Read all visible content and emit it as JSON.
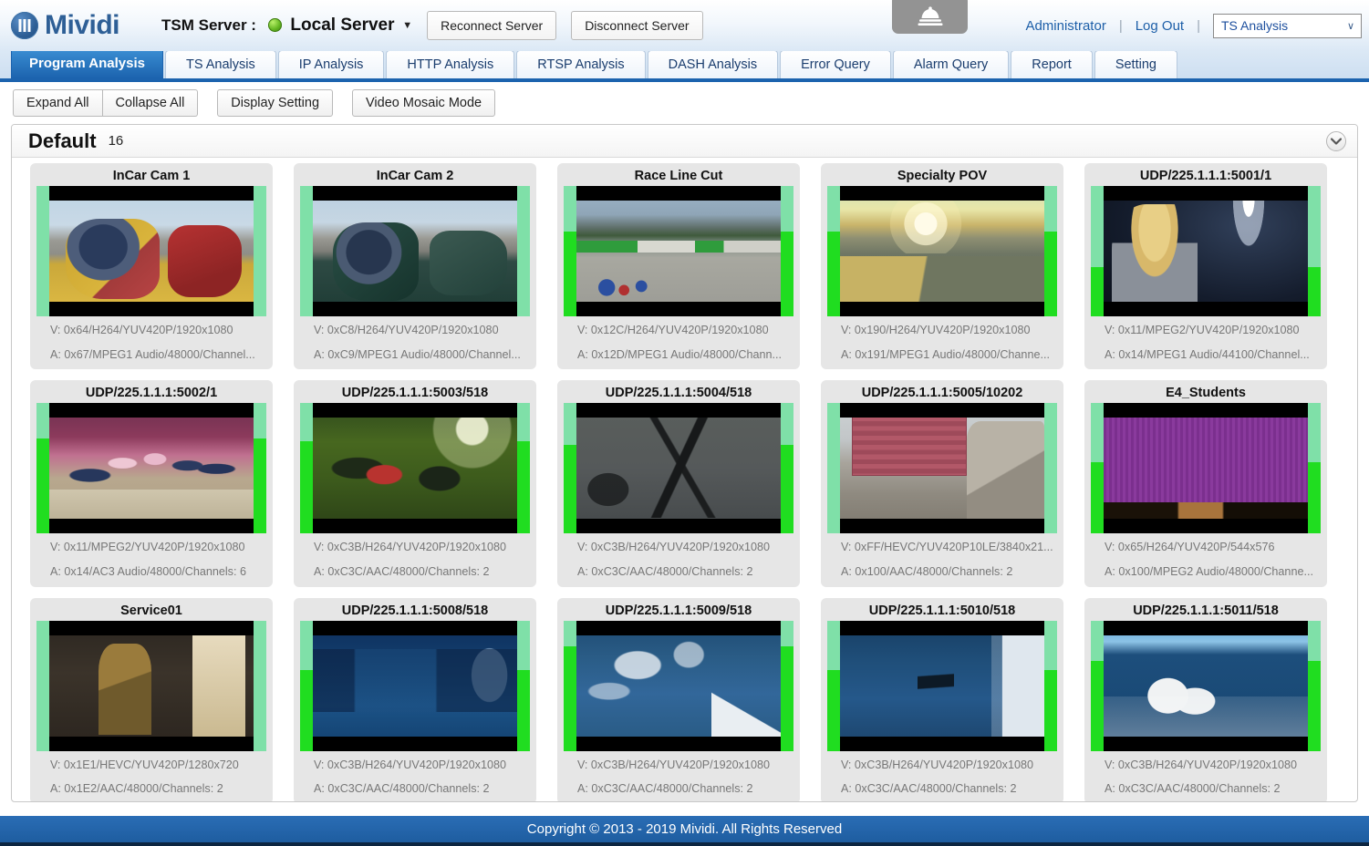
{
  "header": {
    "brand": "Mividi",
    "brand_icon": "mividi-logo-icon",
    "tsm_label": "TSM Server :",
    "status_icon": "green-status-dot-icon",
    "server_name": "Local Server",
    "server_caret": "▼",
    "reconnect_label": "Reconnect Server",
    "disconnect_label": "Disconnect Server",
    "bell_icon": "service-bell-icon",
    "administrator_label": "Administrator",
    "separator": "|",
    "logout_label": "Log Out",
    "analysis_select_value": "TS Analysis",
    "analysis_select_chevron": "∨"
  },
  "tabs": [
    {
      "label": "Program Analysis",
      "active": true
    },
    {
      "label": "TS Analysis",
      "active": false
    },
    {
      "label": "IP Analysis",
      "active": false
    },
    {
      "label": "HTTP Analysis",
      "active": false
    },
    {
      "label": "RTSP Analysis",
      "active": false
    },
    {
      "label": "DASH Analysis",
      "active": false
    },
    {
      "label": "Error Query",
      "active": false
    },
    {
      "label": "Alarm Query",
      "active": false
    },
    {
      "label": "Report",
      "active": false
    },
    {
      "label": "Setting",
      "active": false
    }
  ],
  "toolbar": {
    "expand_all": "Expand All",
    "collapse_all": "Collapse All",
    "display_setting": "Display Setting",
    "video_mosaic_mode": "Video Mosaic Mode"
  },
  "panel": {
    "title": "Default",
    "count": "16",
    "collapse_icon": "chevron-down-circle-icon"
  },
  "cards": [
    {
      "title": "InCar Cam 1",
      "video": "V: 0x64/H264/YUV420P/1920x1080",
      "audio": "A: 0x67/MPEG1 Audio/48000/Channel...",
      "art": "a-incar1",
      "bar_split": 100
    },
    {
      "title": "InCar Cam 2",
      "video": "V: 0xC8/H264/YUV420P/1920x1080",
      "audio": "A: 0xC9/MPEG1 Audio/48000/Channel...",
      "art": "a-incar2",
      "bar_split": 100
    },
    {
      "title": "Race Line Cut",
      "video": "V: 0x12C/H264/YUV420P/1920x1080",
      "audio": "A: 0x12D/MPEG1 Audio/48000/Chann...",
      "art": "a-raceline",
      "bar_split": 35
    },
    {
      "title": "Specialty POV",
      "video": "V: 0x190/H264/YUV420P/1920x1080",
      "audio": "A: 0x191/MPEG1 Audio/48000/Channe...",
      "art": "a-specialty",
      "bar_split": 35
    },
    {
      "title": "UDP/225.1.1.1:5001/1",
      "video": "V: 0x11/MPEG2/YUV420P/1920x1080",
      "audio": "A: 0x14/MPEG1 Audio/44100/Channel...",
      "art": "a-singer",
      "bar_split": 62
    },
    {
      "title": "UDP/225.1.1.1:5002/1",
      "video": "V: 0x11/MPEG2/YUV420P/1920x1080",
      "audio": "A: 0x14/AC3 Audio/48000/Channels: 6",
      "art": "a-kpop",
      "bar_split": 27
    },
    {
      "title": "UDP/225.1.1.1:5003/518",
      "video": "V: 0xC3B/H264/YUV420P/1920x1080",
      "audio": "A: 0xC3C/AAC/48000/Channels: 2",
      "art": "a-jungle",
      "bar_split": 29
    },
    {
      "title": "UDP/225.1.1.1:5004/518",
      "video": "V: 0xC3B/H264/YUV420P/1920x1080",
      "audio": "A: 0xC3C/AAC/48000/Channels: 2",
      "art": "a-branch",
      "bar_split": 32
    },
    {
      "title": "UDP/225.1.1.1:5005/10202",
      "video": "V: 0xFF/HEVC/YUV420P10LE/3840x21...",
      "audio": "A: 0x100/AAC/48000/Channels: 2",
      "art": "a-rubble",
      "bar_split": 100
    },
    {
      "title": "E4_Students",
      "video": "V: 0x65/H264/YUV420P/544x576",
      "audio": "A: 0x100/MPEG2 Audio/48000/Channe...",
      "art": "a-e4",
      "bar_split": 45
    },
    {
      "title": "Service01",
      "video": "V: 0x1E1/HEVC/YUV420P/1280x720",
      "audio": "A: 0x1E2/AAC/48000/Channels: 2",
      "art": "a-store",
      "bar_split": 100
    },
    {
      "title": "UDP/225.1.1.1:5008/518",
      "video": "V: 0xC3B/H264/YUV420P/1920x1080",
      "audio": "A: 0xC3C/AAC/48000/Channels: 2",
      "art": "a-captivate",
      "bar_split": 38
    },
    {
      "title": "UDP/225.1.1.1:5009/518",
      "video": "V: 0xC3B/H264/YUV420P/1920x1080",
      "audio": "A: 0xC3C/AAC/48000/Channels: 2",
      "art": "a-sea1",
      "bar_split": 20
    },
    {
      "title": "UDP/225.1.1.1:5010/518",
      "video": "V: 0xC3B/H264/YUV420P/1920x1080",
      "audio": "A: 0xC3C/AAC/48000/Channels: 2",
      "art": "a-sea2",
      "bar_split": 38
    },
    {
      "title": "UDP/225.1.1.1:5011/518",
      "video": "V: 0xC3B/H264/YUV420P/1920x1080",
      "audio": "A: 0xC3C/AAC/48000/Channels: 2",
      "art": "a-sea3",
      "bar_split": 31
    }
  ],
  "colors": {
    "bar_light_green": "#7fe0a8",
    "bar_bright_green": "#20dd20",
    "accent_blue": "#1c63ae",
    "card_bg": "#e6e6e6"
  },
  "footer": {
    "copyright": "Copyright © 2013 - 2019 Mividi. All Rights Reserved"
  }
}
